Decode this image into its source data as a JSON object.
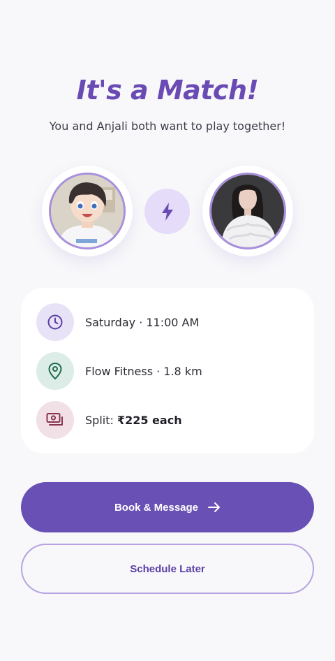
{
  "header": {
    "title": "It's a Match!",
    "subtitle": "You and Anjali both want to play together!"
  },
  "avatars": {
    "left_icon": "user-avatar-icon",
    "center_icon": "lightning-bolt-icon",
    "right_icon": "match-avatar-icon"
  },
  "details": {
    "time": {
      "icon": "clock-icon",
      "text": "Saturday · 11:00 AM"
    },
    "location": {
      "icon": "location-pin-icon",
      "text": "Flow Fitness · 1.8 km"
    },
    "split": {
      "icon": "cash-icon",
      "label": "Split: ",
      "amount": "₹225 each"
    }
  },
  "actions": {
    "primary_label": "Book & Message",
    "primary_icon": "arrow-right-icon",
    "secondary_label": "Schedule Later"
  },
  "colors": {
    "accent": "#6850b4",
    "title": "#6a4bb3",
    "background": "#f8f8fa",
    "avatar_border": "#a78fdb",
    "bolt_bg": "#e4dcf8"
  }
}
